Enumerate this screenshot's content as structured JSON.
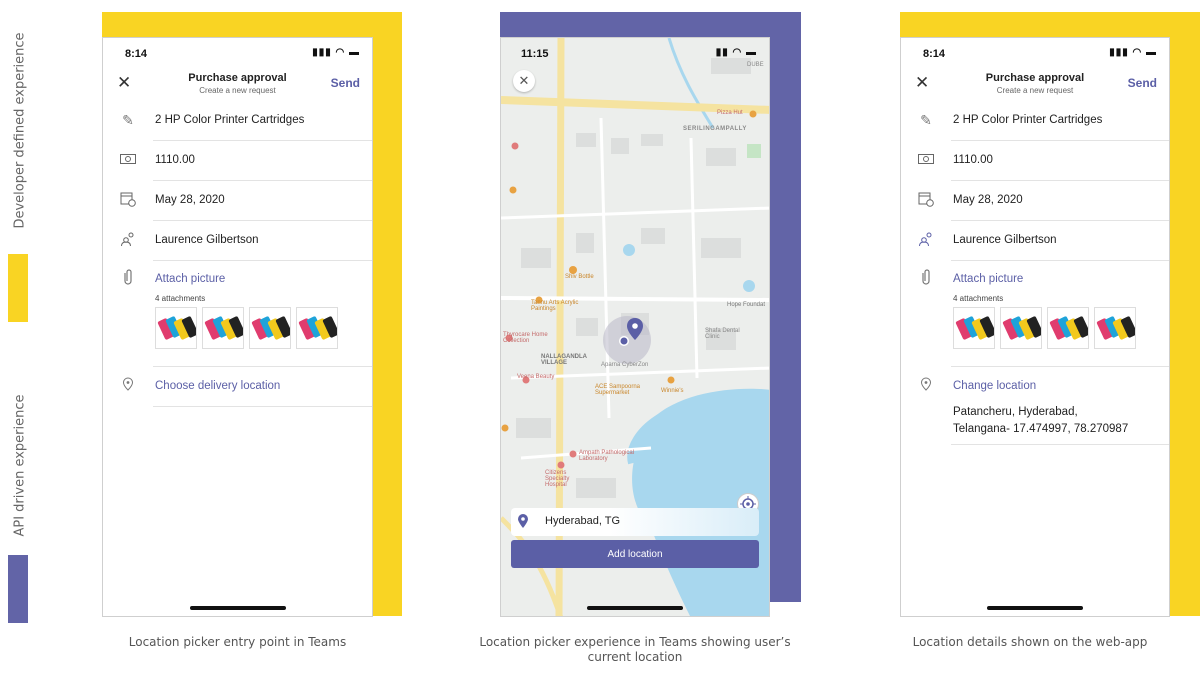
{
  "side_labels": {
    "top": "Developer defined experience",
    "bottom": "API driven experience"
  },
  "colors": {
    "yellow": "#f9d423",
    "purple": "#6264a7",
    "link": "#5b5fa6"
  },
  "phone1": {
    "time": "8:14",
    "title": "Purchase approval",
    "subtitle": "Create a new request",
    "send": "Send",
    "item": "2 HP Color Printer Cartridges",
    "amount": "1110.00",
    "date": "May 28, 2020",
    "person": "Laurence Gilbertson",
    "attach_label": "Attach picture",
    "attach_count": "4 attachments",
    "location_label": "Choose delivery location",
    "caption": "Location picker entry point in Teams"
  },
  "phone2": {
    "time": "11:15",
    "location": "Hyderabad,  TG",
    "add_button": "Add location",
    "caption": "Location picker experience in Teams showing user’s current location",
    "map_labels": [
      "SERILINGAMPALLY",
      "Pizza Hut",
      "Shiv Bottle",
      "Tannu Arts Acrylic Paintings",
      "Hope Foundat",
      "Thyrocare Home Collection",
      "NALLAGANDLA VILLAGE",
      "Aparna CyberZon",
      "Shafa Dental Clinic",
      "Veena Beauty",
      "ACE Sampoorna Supermarket",
      "Winnie's",
      "Ampath Pathological Laboratory",
      "Citizens Specialty Hospital",
      "DUBE"
    ]
  },
  "phone3": {
    "time": "8:14",
    "title": "Purchase approval",
    "subtitle": "Create a new request",
    "send": "Send",
    "item": "2 HP Color Printer Cartridges",
    "amount": "1110.00",
    "date": "May 28, 2020",
    "person": "Laurence Gilbertson",
    "attach_label": "Attach picture",
    "attach_count": "4 attachments",
    "location_label": "Change location",
    "address_line1": "Patancheru, Hyderabad,",
    "address_line2": "Telangana- 17.474997, 78.270987",
    "caption": "Location details shown on the web-app"
  }
}
